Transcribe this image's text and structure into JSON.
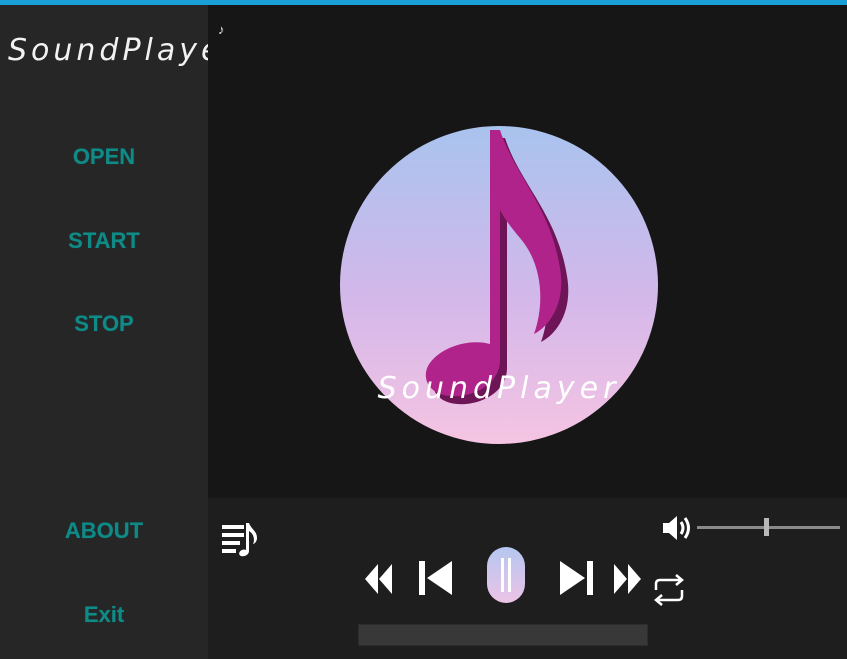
{
  "app": {
    "name": "SoundPlayer"
  },
  "sidebar": {
    "items": [
      {
        "label": "OPEN"
      },
      {
        "label": "START"
      },
      {
        "label": "STOP"
      },
      {
        "label": "ABOUT"
      },
      {
        "label": "Exit"
      }
    ]
  },
  "main": {
    "small_note_icon": "♪",
    "album_art_text": "SoundPlayer"
  },
  "player": {
    "volume": 0.47,
    "progress": 0.0,
    "icons": [
      "playlist-icon",
      "volume-icon",
      "fast-rewind-icon",
      "skip-previous-icon",
      "pause-icon",
      "skip-next-icon",
      "fast-forward-icon",
      "repeat-icon"
    ]
  },
  "colors": {
    "accent": "#0f8a86",
    "top_bar": "#1aa0d8",
    "note_magenta": "#b0238a"
  }
}
